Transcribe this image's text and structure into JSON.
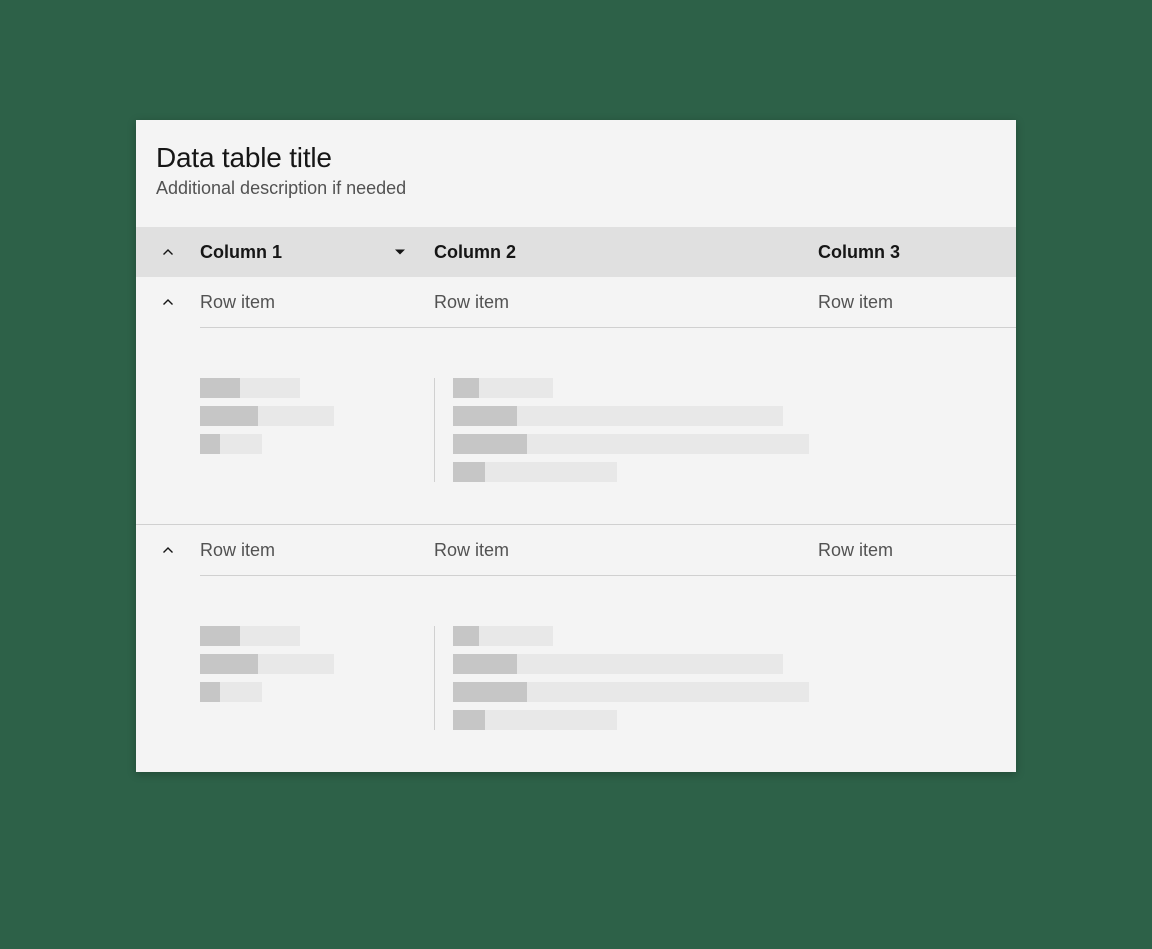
{
  "header": {
    "title": "Data table title",
    "subtitle": "Additional description if needed"
  },
  "columns": {
    "col1": "Column 1",
    "col2": "Column 2",
    "col3": "Column 3"
  },
  "rows": [
    {
      "expanded": true,
      "cells": {
        "col1": "Row item",
        "col2": "Row item",
        "col3": "Row item"
      }
    },
    {
      "expanded": true,
      "cells": {
        "col1": "Row item",
        "col2": "Row item",
        "col3": "Row item"
      }
    }
  ]
}
